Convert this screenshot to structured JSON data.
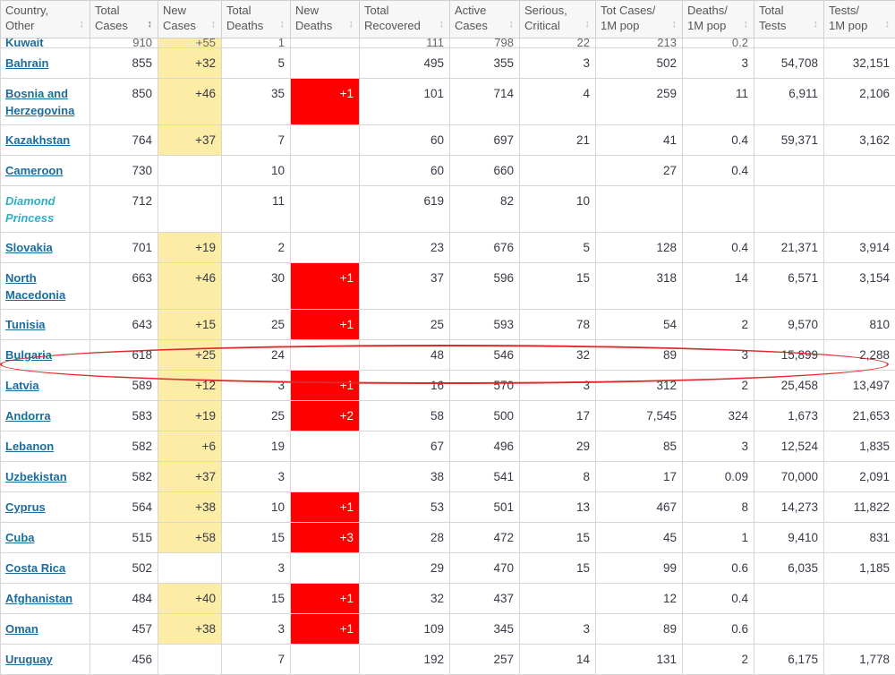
{
  "headers": [
    [
      "Country,",
      "Other"
    ],
    [
      "Total",
      "Cases"
    ],
    [
      "New",
      "Cases"
    ],
    [
      "Total",
      "Deaths"
    ],
    [
      "New",
      "Deaths"
    ],
    [
      "Total",
      "Recovered"
    ],
    [
      "Active",
      "Cases"
    ],
    [
      "Serious,",
      "Critical"
    ],
    [
      "Tot Cases/",
      "1M pop"
    ],
    [
      "Deaths/",
      "1M pop"
    ],
    [
      "Total",
      "Tests"
    ],
    [
      "Tests/",
      "1M pop"
    ]
  ],
  "sort_icon": "↕",
  "cut_row": {
    "country": "Kuwait",
    "total": "910",
    "new": "+55",
    "deaths": "1",
    "newdeaths": "",
    "recovered": "111",
    "active": "798",
    "serious": "22",
    "per1m": "213",
    "deaths1m": "0.2",
    "tests": "",
    "tests1m": ""
  },
  "rows": [
    {
      "country": "Bahrain",
      "total": "855",
      "new": "+32",
      "deaths": "5",
      "newdeaths": "",
      "recovered": "495",
      "active": "355",
      "serious": "3",
      "per1m": "502",
      "deaths1m": "3",
      "tests": "54,708",
      "tests1m": "32,151"
    },
    {
      "country": "Bosnia and Herzegovina",
      "total": "850",
      "new": "+46",
      "deaths": "35",
      "newdeaths": "+1",
      "recovered": "101",
      "active": "714",
      "serious": "4",
      "per1m": "259",
      "deaths1m": "11",
      "tests": "6,911",
      "tests1m": "2,106"
    },
    {
      "country": "Kazakhstan",
      "total": "764",
      "new": "+37",
      "deaths": "7",
      "newdeaths": "",
      "recovered": "60",
      "active": "697",
      "serious": "21",
      "per1m": "41",
      "deaths1m": "0.4",
      "tests": "59,371",
      "tests1m": "3,162"
    },
    {
      "country": "Cameroon",
      "total": "730",
      "new": "",
      "deaths": "10",
      "newdeaths": "",
      "recovered": "60",
      "active": "660",
      "serious": "",
      "per1m": "27",
      "deaths1m": "0.4",
      "tests": "",
      "tests1m": ""
    },
    {
      "country": "Diamond Princess",
      "total": "712",
      "new": "",
      "deaths": "11",
      "newdeaths": "",
      "recovered": "619",
      "active": "82",
      "serious": "10",
      "per1m": "",
      "deaths1m": "",
      "tests": "",
      "tests1m": "",
      "italic": true
    },
    {
      "country": "Slovakia",
      "total": "701",
      "new": "+19",
      "deaths": "2",
      "newdeaths": "",
      "recovered": "23",
      "active": "676",
      "serious": "5",
      "per1m": "128",
      "deaths1m": "0.4",
      "tests": "21,371",
      "tests1m": "3,914"
    },
    {
      "country": "North Macedonia",
      "total": "663",
      "new": "+46",
      "deaths": "30",
      "newdeaths": "+1",
      "recovered": "37",
      "active": "596",
      "serious": "15",
      "per1m": "318",
      "deaths1m": "14",
      "tests": "6,571",
      "tests1m": "3,154"
    },
    {
      "country": "Tunisia",
      "total": "643",
      "new": "+15",
      "deaths": "25",
      "newdeaths": "+1",
      "recovered": "25",
      "active": "593",
      "serious": "78",
      "per1m": "54",
      "deaths1m": "2",
      "tests": "9,570",
      "tests1m": "810"
    },
    {
      "country": "Bulgaria",
      "total": "618",
      "new": "+25",
      "deaths": "24",
      "newdeaths": "",
      "recovered": "48",
      "active": "546",
      "serious": "32",
      "per1m": "89",
      "deaths1m": "3",
      "tests": "15,899",
      "tests1m": "2,288"
    },
    {
      "country": "Latvia",
      "total": "589",
      "new": "+12",
      "deaths": "3",
      "newdeaths": "+1",
      "recovered": "16",
      "active": "570",
      "serious": "3",
      "per1m": "312",
      "deaths1m": "2",
      "tests": "25,458",
      "tests1m": "13,497"
    },
    {
      "country": "Andorra",
      "total": "583",
      "new": "+19",
      "deaths": "25",
      "newdeaths": "+2",
      "recovered": "58",
      "active": "500",
      "serious": "17",
      "per1m": "7,545",
      "deaths1m": "324",
      "tests": "1,673",
      "tests1m": "21,653"
    },
    {
      "country": "Lebanon",
      "total": "582",
      "new": "+6",
      "deaths": "19",
      "newdeaths": "",
      "recovered": "67",
      "active": "496",
      "serious": "29",
      "per1m": "85",
      "deaths1m": "3",
      "tests": "12,524",
      "tests1m": "1,835"
    },
    {
      "country": "Uzbekistan",
      "total": "582",
      "new": "+37",
      "deaths": "3",
      "newdeaths": "",
      "recovered": "38",
      "active": "541",
      "serious": "8",
      "per1m": "17",
      "deaths1m": "0.09",
      "tests": "70,000",
      "tests1m": "2,091"
    },
    {
      "country": "Cyprus",
      "total": "564",
      "new": "+38",
      "deaths": "10",
      "newdeaths": "+1",
      "recovered": "53",
      "active": "501",
      "serious": "13",
      "per1m": "467",
      "deaths1m": "8",
      "tests": "14,273",
      "tests1m": "11,822"
    },
    {
      "country": "Cuba",
      "total": "515",
      "new": "+58",
      "deaths": "15",
      "newdeaths": "+3",
      "recovered": "28",
      "active": "472",
      "serious": "15",
      "per1m": "45",
      "deaths1m": "1",
      "tests": "9,410",
      "tests1m": "831"
    },
    {
      "country": "Costa Rica",
      "total": "502",
      "new": "",
      "deaths": "3",
      "newdeaths": "",
      "recovered": "29",
      "active": "470",
      "serious": "15",
      "per1m": "99",
      "deaths1m": "0.6",
      "tests": "6,035",
      "tests1m": "1,185"
    },
    {
      "country": "Afghanistan",
      "total": "484",
      "new": "+40",
      "deaths": "15",
      "newdeaths": "+1",
      "recovered": "32",
      "active": "437",
      "serious": "",
      "per1m": "12",
      "deaths1m": "0.4",
      "tests": "",
      "tests1m": ""
    },
    {
      "country": "Oman",
      "total": "457",
      "new": "+38",
      "deaths": "3",
      "newdeaths": "+1",
      "recovered": "109",
      "active": "345",
      "serious": "3",
      "per1m": "89",
      "deaths1m": "0.6",
      "tests": "",
      "tests1m": ""
    },
    {
      "country": "Uruguay",
      "total": "456",
      "new": "",
      "deaths": "7",
      "newdeaths": "",
      "recovered": "192",
      "active": "257",
      "serious": "14",
      "per1m": "131",
      "deaths1m": "2",
      "tests": "6,175",
      "tests1m": "1,778"
    }
  ],
  "highlighted_row": "Bulgaria",
  "colors": {
    "new_cases_bg": "#fdeca6",
    "new_deaths_bg": "#ff0000",
    "link": "#1b6c9e",
    "ship": "#2ab0c6",
    "ring": "#e0282b"
  }
}
